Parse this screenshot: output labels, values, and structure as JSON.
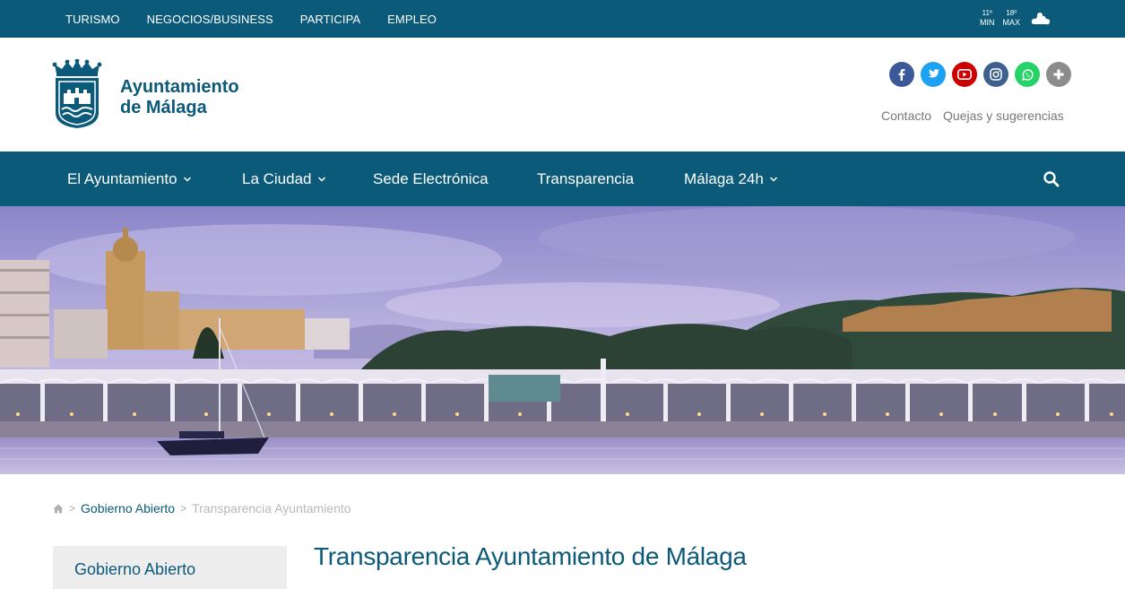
{
  "topbar": {
    "links": [
      "TURISMO",
      "NEGOCIOS/BUSINESS",
      "PARTICIPA",
      "EMPLEO"
    ],
    "weather": {
      "min_temp": "11º",
      "min_label": "MIN",
      "max_temp": "18º",
      "max_label": "MAX",
      "icon": "cloud-icon"
    }
  },
  "header": {
    "brand_line1": "Ayuntamiento",
    "brand_line2": "de Málaga",
    "social": [
      {
        "name": "facebook",
        "color": "#3b5998"
      },
      {
        "name": "twitter",
        "color": "#1da1f2"
      },
      {
        "name": "youtube",
        "color": "#cc0000"
      },
      {
        "name": "instagram",
        "color": "#3f5f8f"
      },
      {
        "name": "whatsapp",
        "color": "#25d366"
      },
      {
        "name": "more",
        "color": "#8c8c8c"
      }
    ],
    "links": [
      "Contacto",
      "Quejas y sugerencias"
    ]
  },
  "nav": {
    "items": [
      {
        "label": "El Ayuntamiento",
        "has_dropdown": true
      },
      {
        "label": "La Ciudad",
        "has_dropdown": true
      },
      {
        "label": "Sede Electrónica",
        "has_dropdown": false
      },
      {
        "label": "Transparencia",
        "has_dropdown": false
      },
      {
        "label": "Málaga 24h",
        "has_dropdown": true
      }
    ]
  },
  "breadcrumb": {
    "separator": ">",
    "parent": "Gobierno Abierto",
    "current": "Transparencia Ayuntamiento"
  },
  "sidebar": {
    "title": "Gobierno Abierto"
  },
  "main": {
    "title": "Transparencia Ayuntamiento de Málaga"
  },
  "colors": {
    "brand": "#0b5a7a",
    "sidebar_bg": "#ededed"
  }
}
